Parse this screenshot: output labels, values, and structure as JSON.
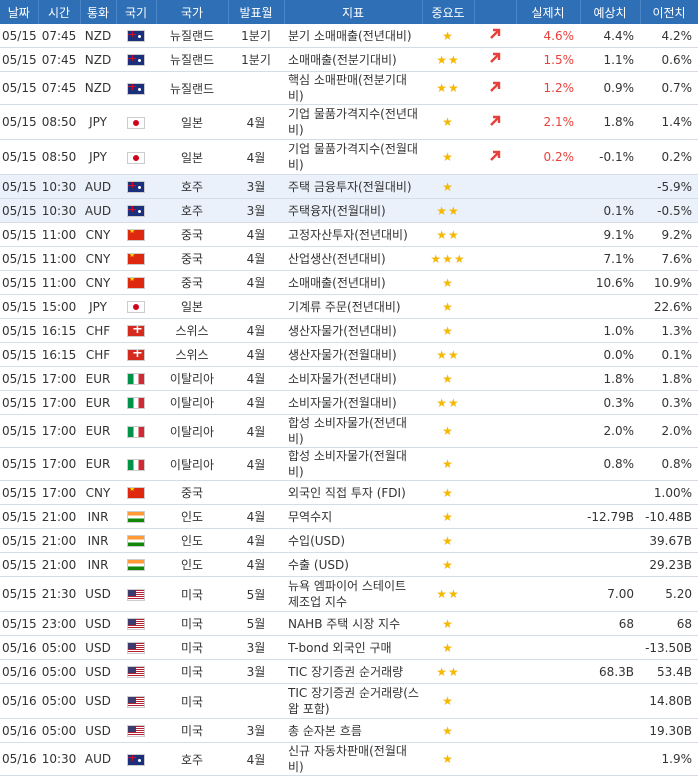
{
  "headers": [
    "날짜",
    "시간",
    "통화",
    "국기",
    "국가",
    "발표월",
    "지표",
    "중요도",
    "",
    "실제치",
    "예상치",
    "이전치"
  ],
  "rows": [
    {
      "date": "05/15",
      "time": "07:45",
      "cur": "NZD",
      "flag": "nz",
      "country": "뉴질랜드",
      "period": "1분기",
      "indicator": "분기 소매매출(전년대비)",
      "stars": "★",
      "arrow": "up",
      "actual": "4.6%",
      "forecast": "4.4%",
      "previous": "4.2%",
      "tall": false,
      "hl": false
    },
    {
      "date": "05/15",
      "time": "07:45",
      "cur": "NZD",
      "flag": "nz",
      "country": "뉴질랜드",
      "period": "1분기",
      "indicator": "소매매출(전분기대비)",
      "stars": "★★",
      "arrow": "up",
      "actual": "1.5%",
      "forecast": "1.1%",
      "previous": "0.6%",
      "tall": false,
      "hl": false
    },
    {
      "date": "05/15",
      "time": "07:45",
      "cur": "NZD",
      "flag": "nz",
      "country": "뉴질랜드",
      "period": "",
      "indicator": "핵심 소매판매(전분기대비)",
      "stars": "★★",
      "arrow": "up",
      "actual": "1.2%",
      "forecast": "0.9%",
      "previous": "0.7%",
      "tall": false,
      "hl": false
    },
    {
      "date": "05/15",
      "time": "08:50",
      "cur": "JPY",
      "flag": "jp",
      "country": "일본",
      "period": "4월",
      "indicator": "기업 물품가격지수(전년대비)",
      "stars": "★",
      "arrow": "up",
      "actual": "2.1%",
      "forecast": "1.8%",
      "previous": "1.4%",
      "tall": true,
      "hl": false
    },
    {
      "date": "05/15",
      "time": "08:50",
      "cur": "JPY",
      "flag": "jp",
      "country": "일본",
      "period": "4월",
      "indicator": "기업 물품가격지수(전월대비)",
      "stars": "★",
      "arrow": "up",
      "actual": "0.2%",
      "forecast": "-0.1%",
      "previous": "0.2%",
      "tall": true,
      "hl": false
    },
    {
      "date": "05/15",
      "time": "10:30",
      "cur": "AUD",
      "flag": "au",
      "country": "호주",
      "period": "3월",
      "indicator": "주택 금융투자(전월대비)",
      "stars": "★",
      "arrow": "",
      "actual": "",
      "forecast": "",
      "previous": "-5.9%",
      "tall": false,
      "hl": true
    },
    {
      "date": "05/15",
      "time": "10:30",
      "cur": "AUD",
      "flag": "au",
      "country": "호주",
      "period": "3월",
      "indicator": "주택융자(전월대비)",
      "stars": "★★",
      "arrow": "",
      "actual": "",
      "forecast": "0.1%",
      "previous": "-0.5%",
      "tall": false,
      "hl": true
    },
    {
      "date": "05/15",
      "time": "11:00",
      "cur": "CNY",
      "flag": "cn",
      "country": "중국",
      "period": "4월",
      "indicator": "고정자산투자(전년대비)",
      "stars": "★★",
      "arrow": "",
      "actual": "",
      "forecast": "9.1%",
      "previous": "9.2%",
      "tall": false,
      "hl": false
    },
    {
      "date": "05/15",
      "time": "11:00",
      "cur": "CNY",
      "flag": "cn",
      "country": "중국",
      "period": "4월",
      "indicator": "산업생산(전년대비)",
      "stars": "★★★",
      "arrow": "",
      "actual": "",
      "forecast": "7.1%",
      "previous": "7.6%",
      "tall": false,
      "hl": false
    },
    {
      "date": "05/15",
      "time": "11:00",
      "cur": "CNY",
      "flag": "cn",
      "country": "중국",
      "period": "4월",
      "indicator": "소매매출(전년대비)",
      "stars": "★",
      "arrow": "",
      "actual": "",
      "forecast": "10.6%",
      "previous": "10.9%",
      "tall": false,
      "hl": false
    },
    {
      "date": "05/15",
      "time": "15:00",
      "cur": "JPY",
      "flag": "jp",
      "country": "일본",
      "period": "",
      "indicator": "기계류 주문(전년대비)",
      "stars": "★",
      "arrow": "",
      "actual": "",
      "forecast": "",
      "previous": "22.6%",
      "tall": false,
      "hl": false
    },
    {
      "date": "05/15",
      "time": "16:15",
      "cur": "CHF",
      "flag": "ch",
      "country": "스위스",
      "period": "4월",
      "indicator": "생산자물가(전년대비)",
      "stars": "★",
      "arrow": "",
      "actual": "",
      "forecast": "1.0%",
      "previous": "1.3%",
      "tall": false,
      "hl": false
    },
    {
      "date": "05/15",
      "time": "16:15",
      "cur": "CHF",
      "flag": "ch",
      "country": "스위스",
      "period": "4월",
      "indicator": "생산자물가(전월대비)",
      "stars": "★★",
      "arrow": "",
      "actual": "",
      "forecast": "0.0%",
      "previous": "0.1%",
      "tall": false,
      "hl": false
    },
    {
      "date": "05/15",
      "time": "17:00",
      "cur": "EUR",
      "flag": "it",
      "country": "이탈리아",
      "period": "4월",
      "indicator": "소비자물가(전년대비)",
      "stars": "★",
      "arrow": "",
      "actual": "",
      "forecast": "1.8%",
      "previous": "1.8%",
      "tall": false,
      "hl": false
    },
    {
      "date": "05/15",
      "time": "17:00",
      "cur": "EUR",
      "flag": "it",
      "country": "이탈리아",
      "period": "4월",
      "indicator": "소비자물가(전월대비)",
      "stars": "★★",
      "arrow": "",
      "actual": "",
      "forecast": "0.3%",
      "previous": "0.3%",
      "tall": false,
      "hl": false
    },
    {
      "date": "05/15",
      "time": "17:00",
      "cur": "EUR",
      "flag": "it",
      "country": "이탈리아",
      "period": "4월",
      "indicator": "합성 소비자물가(전년대비)",
      "stars": "★",
      "arrow": "",
      "actual": "",
      "forecast": "2.0%",
      "previous": "2.0%",
      "tall": false,
      "hl": false
    },
    {
      "date": "05/15",
      "time": "17:00",
      "cur": "EUR",
      "flag": "it",
      "country": "이탈리아",
      "period": "4월",
      "indicator": "합성 소비자물가(전월대비)",
      "stars": "★",
      "arrow": "",
      "actual": "",
      "forecast": "0.8%",
      "previous": "0.8%",
      "tall": false,
      "hl": false
    },
    {
      "date": "05/15",
      "time": "17:00",
      "cur": "CNY",
      "flag": "cn",
      "country": "중국",
      "period": "",
      "indicator": "외국인 직접 투자 (FDI)",
      "stars": "★",
      "arrow": "",
      "actual": "",
      "forecast": "",
      "previous": "1.00%",
      "tall": false,
      "hl": false
    },
    {
      "date": "05/15",
      "time": "21:00",
      "cur": "INR",
      "flag": "in",
      "country": "인도",
      "period": "4월",
      "indicator": "무역수지",
      "stars": "★",
      "arrow": "",
      "actual": "",
      "forecast": "-12.79B",
      "previous": "-10.48B",
      "tall": false,
      "hl": false
    },
    {
      "date": "05/15",
      "time": "21:00",
      "cur": "INR",
      "flag": "in",
      "country": "인도",
      "period": "4월",
      "indicator": "수입(USD)",
      "stars": "★",
      "arrow": "",
      "actual": "",
      "forecast": "",
      "previous": "39.67B",
      "tall": false,
      "hl": false
    },
    {
      "date": "05/15",
      "time": "21:00",
      "cur": "INR",
      "flag": "in",
      "country": "인도",
      "period": "4월",
      "indicator": "수출 (USD)",
      "stars": "★",
      "arrow": "",
      "actual": "",
      "forecast": "",
      "previous": "29.23B",
      "tall": false,
      "hl": false
    },
    {
      "date": "05/15",
      "time": "21:30",
      "cur": "USD",
      "flag": "us",
      "country": "미국",
      "period": "5월",
      "indicator": "뉴욕 엠파이어 스테이트 제조업 지수",
      "stars": "★★",
      "arrow": "",
      "actual": "",
      "forecast": "7.00",
      "previous": "5.20",
      "tall": true,
      "hl": false
    },
    {
      "date": "05/15",
      "time": "23:00",
      "cur": "USD",
      "flag": "us",
      "country": "미국",
      "period": "5월",
      "indicator": "NAHB 주택 시장 지수",
      "stars": "★",
      "arrow": "",
      "actual": "",
      "forecast": "68",
      "previous": "68",
      "tall": false,
      "hl": false
    },
    {
      "date": "05/16",
      "time": "05:00",
      "cur": "USD",
      "flag": "us",
      "country": "미국",
      "period": "3월",
      "indicator": "T-bond 외국인 구매",
      "stars": "★",
      "arrow": "",
      "actual": "",
      "forecast": "",
      "previous": "-13.50B",
      "tall": false,
      "hl": false
    },
    {
      "date": "05/16",
      "time": "05:00",
      "cur": "USD",
      "flag": "us",
      "country": "미국",
      "period": "3월",
      "indicator": "TIC 장기증권 순거래량",
      "stars": "★★",
      "arrow": "",
      "actual": "",
      "forecast": "68.3B",
      "previous": "53.4B",
      "tall": false,
      "hl": false
    },
    {
      "date": "05/16",
      "time": "05:00",
      "cur": "USD",
      "flag": "us",
      "country": "미국",
      "period": "",
      "indicator": "TIC 장기증권 순거래량(스왑 포함)",
      "stars": "★",
      "arrow": "",
      "actual": "",
      "forecast": "",
      "previous": "14.80B",
      "tall": true,
      "hl": false
    },
    {
      "date": "05/16",
      "time": "05:00",
      "cur": "USD",
      "flag": "us",
      "country": "미국",
      "period": "3월",
      "indicator": "총 순자본 흐름",
      "stars": "★",
      "arrow": "",
      "actual": "",
      "forecast": "",
      "previous": "19.30B",
      "tall": false,
      "hl": false
    },
    {
      "date": "05/16",
      "time": "10:30",
      "cur": "AUD",
      "flag": "au",
      "country": "호주",
      "period": "4월",
      "indicator": "신규 자동차판매(전월대비)",
      "stars": "★",
      "arrow": "",
      "actual": "",
      "forecast": "",
      "previous": "1.9%",
      "tall": false,
      "hl": false
    }
  ]
}
